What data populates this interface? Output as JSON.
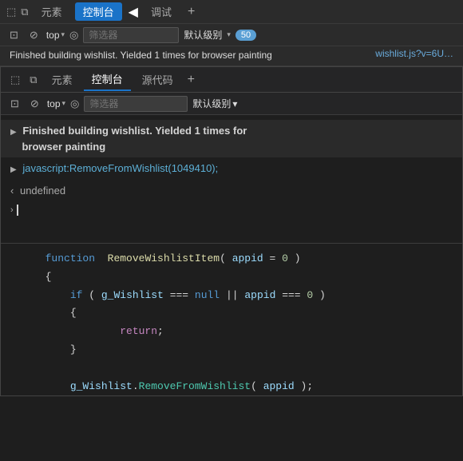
{
  "topBar": {
    "icons": [
      "inspect",
      "layers"
    ],
    "tabs": [
      {
        "label": "元素",
        "active": false
      },
      {
        "label": "控制台",
        "active": true
      },
      {
        "label": "调试",
        "active": false
      }
    ],
    "plus": "+",
    "arrowLabel": "▶"
  },
  "topToolbar": {
    "clearIcon": "⊘",
    "topSelector": "top",
    "caretDown": "▾",
    "eyeIcon": "👁",
    "filterPlaceholder": "筛选器",
    "defaultLevel": "默认级别",
    "badge": "50"
  },
  "topLog": {
    "message": "Finished building wishlist. Yielded 1 times for\nbrowser painting",
    "linkText": "wishlist.js?v=6U…",
    "linkHref": "#"
  },
  "panel": {
    "tabbar": {
      "icons": [
        "inspect",
        "layers"
      ],
      "tabs": [
        {
          "label": "元素",
          "active": false
        },
        {
          "label": "控制台",
          "active": true
        },
        {
          "label": "源代码",
          "active": false
        }
      ],
      "plus": "+"
    },
    "toolbar": {
      "clearIcon": "⊘",
      "topSelector": "top",
      "caretDown": "▾",
      "eyeIcon": "👁",
      "filterPlaceholder": "筛选器",
      "defaultLevel": "默认级别",
      "caretDown2": "▾"
    },
    "console": {
      "logMessage": "Finished building wishlist. Yielded 1 times for\n    browser painting",
      "jsCommand": "javascript:RemoveFromWishlist(1049410);",
      "undefinedText": "undefined",
      "promptSymbol": "›"
    }
  },
  "codeSection": {
    "lines": [
      {
        "indent": 2,
        "content": "function RemoveWishlistItem( appid = 0 )"
      },
      {
        "indent": 2,
        "content": "{"
      },
      {
        "indent": 3,
        "content": "if ( g_Wishlist === null || appid === 0 )"
      },
      {
        "indent": 3,
        "content": "{"
      },
      {
        "indent": 5,
        "content": "return;"
      },
      {
        "indent": 3,
        "content": "}"
      },
      {
        "indent": 0,
        "content": ""
      },
      {
        "indent": 3,
        "content": "g_Wishlist.RemoveFromWishlist( appid );"
      }
    ]
  }
}
